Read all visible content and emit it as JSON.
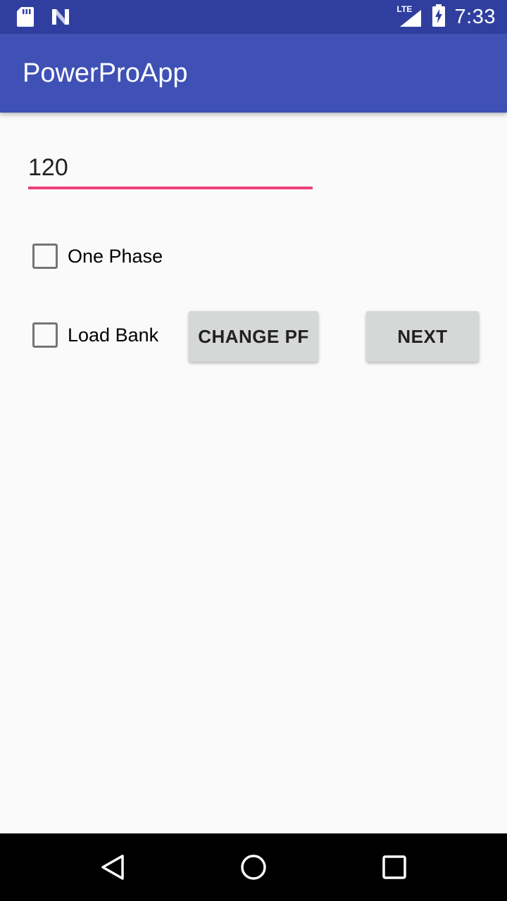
{
  "status_bar": {
    "time": "7:33",
    "network_label": "LTE",
    "icons": [
      "sd-card-icon",
      "n-notification-icon",
      "signal-lte-icon",
      "battery-charging-icon"
    ],
    "background": "#303f9f"
  },
  "app_bar": {
    "title": "PowerProApp",
    "background": "#3f51b5"
  },
  "form": {
    "number_value": "120",
    "accent_color": "#e91e63",
    "checkboxes": [
      {
        "label": "One Phase",
        "checked": false
      },
      {
        "label": "Load Bank",
        "checked": false
      }
    ],
    "change_pf_label": "CHANGE PF",
    "next_label": "NEXT"
  },
  "nav_bar": {
    "icons": [
      "back-icon",
      "home-icon",
      "recents-icon"
    ]
  }
}
